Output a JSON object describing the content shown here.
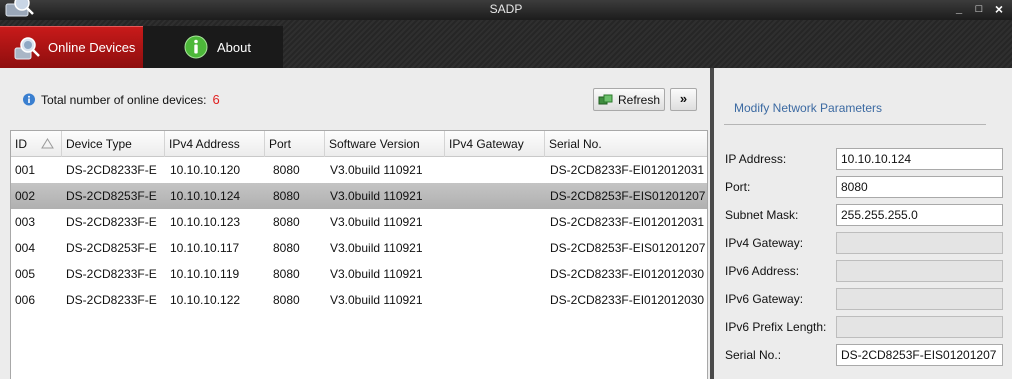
{
  "window": {
    "title": "SADP",
    "minimize": "_",
    "maximize": "□",
    "close": "×"
  },
  "tabs": [
    {
      "label": "Online Devices",
      "icon": "magnifier-computer-icon",
      "active": true
    },
    {
      "label": "About",
      "icon": "info-icon",
      "active": false
    }
  ],
  "toolbar": {
    "count_label": "Total number of online devices:",
    "count_value": "6",
    "refresh_label": "Refresh",
    "expand_label": "»"
  },
  "table": {
    "columns": [
      "ID",
      "Device Type",
      "IPv4 Address",
      "Port",
      "Software Version",
      "IPv4 Gateway",
      "Serial No."
    ],
    "rows": [
      [
        "001",
        "DS-2CD8233F-E",
        "10.10.10.120",
        "8080",
        "V3.0build 110921",
        "",
        "DS-2CD8233F-EI012012031"
      ],
      [
        "002",
        "DS-2CD8253F-E",
        "10.10.10.124",
        "8080",
        "V3.0build 110921",
        "",
        "DS-2CD8253F-EIS01201207"
      ],
      [
        "003",
        "DS-2CD8233F-E",
        "10.10.10.123",
        "8080",
        "V3.0build 110921",
        "",
        "DS-2CD8233F-EI012012031"
      ],
      [
        "004",
        "DS-2CD8253F-E",
        "10.10.10.117",
        "8080",
        "V3.0build 110921",
        "",
        "DS-2CD8253F-EIS01201207"
      ],
      [
        "005",
        "DS-2CD8233F-E",
        "10.10.10.119",
        "8080",
        "V3.0build 110921",
        "",
        "DS-2CD8233F-EI012012030"
      ],
      [
        "006",
        "DS-2CD8233F-E",
        "10.10.10.122",
        "8080",
        "V3.0build 110921",
        "",
        "DS-2CD8233F-EI012012030"
      ]
    ],
    "selected_row": 2
  },
  "side": {
    "title": "Modify Network Parameters",
    "fields": [
      {
        "label": "IP Address:",
        "value": "10.10.10.124",
        "enabled": true
      },
      {
        "label": "Port:",
        "value": "8080",
        "enabled": true
      },
      {
        "label": "Subnet Mask:",
        "value": "255.255.255.0",
        "enabled": true
      },
      {
        "label": "IPv4 Gateway:",
        "value": "",
        "enabled": false
      },
      {
        "label": "IPv6 Address:",
        "value": "",
        "enabled": false
      },
      {
        "label": "IPv6 Gateway:",
        "value": "",
        "enabled": false
      },
      {
        "label": "IPv6 Prefix Length:",
        "value": "",
        "enabled": false
      },
      {
        "label": "Serial No.:",
        "value": "DS-2CD8253F-EIS01201207",
        "enabled": true
      }
    ]
  },
  "colors": {
    "active_tab": "#b01414",
    "count_value": "#e02020",
    "side_title": "#3c6aa2",
    "selected_row": "#b8b8b8"
  }
}
